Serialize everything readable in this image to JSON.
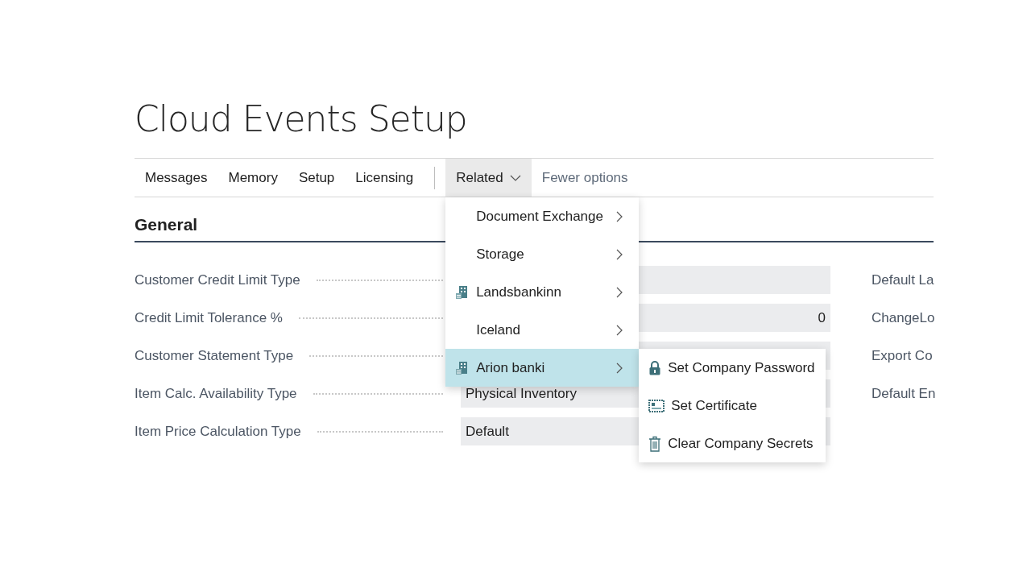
{
  "page": {
    "title": "Cloud Events Setup"
  },
  "actions": [
    {
      "label": "Messages"
    },
    {
      "label": "Memory"
    },
    {
      "label": "Setup"
    },
    {
      "label": "Licensing"
    }
  ],
  "related": {
    "label": "Related",
    "expanded": true,
    "items": [
      {
        "label": "Document Exchange",
        "kind": "plain",
        "selected": false
      },
      {
        "label": "Storage",
        "kind": "plain",
        "selected": false
      },
      {
        "label": "Landsbankinn",
        "kind": "bank",
        "selected": false
      },
      {
        "label": "Iceland",
        "kind": "plain",
        "selected": false
      },
      {
        "label": "Arion banki",
        "kind": "bank",
        "selected": true
      }
    ],
    "submenu": [
      "Set Company Password",
      "Set Certificate",
      "Clear Company Secrets"
    ]
  },
  "fewer_options": "Fewer options",
  "section": {
    "title": "General"
  },
  "fields": [
    {
      "label": "Customer Credit Limit Type",
      "kind": "option",
      "right_label": "Default La"
    },
    {
      "label": "Credit Limit Tolerance %",
      "value": "0",
      "kind": "number",
      "right_label": "ChangeLo"
    },
    {
      "label": "Customer Statement Type",
      "kind": "option",
      "right_label": "Export Co"
    },
    {
      "label": "Item Calc. Availability Type",
      "value": "Physical Inventory",
      "kind": "option",
      "right_label": "Default En"
    },
    {
      "label": "Item Price Calculation Type",
      "value": "Default",
      "kind": "option"
    }
  ]
}
